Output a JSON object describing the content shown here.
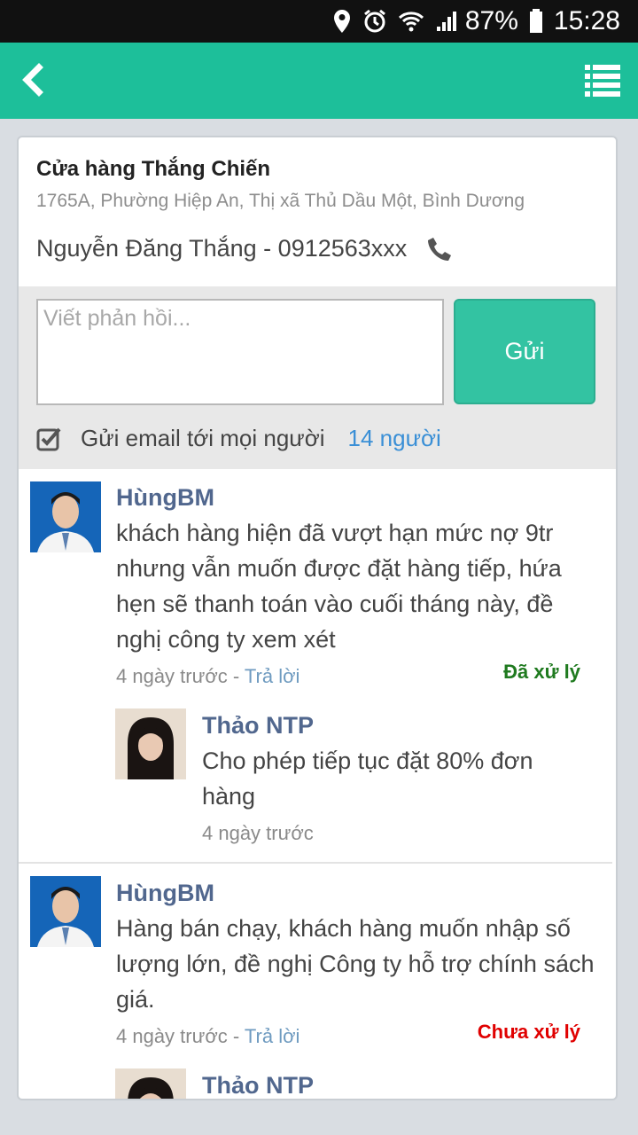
{
  "status_bar": {
    "battery": "87%",
    "time": "15:28",
    "icons": [
      "location-icon",
      "alarm-icon",
      "wifi-icon",
      "signal-icon",
      "battery-icon"
    ]
  },
  "app_bar": {
    "color": "#1dbf9a",
    "back_icon": "back-chevron-icon",
    "menu_icon": "list-menu-icon"
  },
  "store": {
    "name": "Cửa hàng Thắng Chiến",
    "address": "1765A, Phường Hiệp An, Thị xã Thủ Dầu Một, Bình Dương",
    "contact": "Nguyễn Đăng Thắng - 0912563xxx"
  },
  "reply": {
    "placeholder": "Viết phản hồi...",
    "value": "",
    "send_label": "Gửi",
    "email_label": "Gửi email tới mọi người",
    "email_count": "14 người",
    "email_checked": true
  },
  "comments": [
    {
      "author": "HùngBM",
      "text": "khách hàng hiện đã vượt hạn mức nợ 9tr nhưng vẫn muốn được đặt hàng tiếp, hứa hẹn sẽ thanh toán vào cuối tháng này, đề nghị công ty xem xét",
      "time": "4 ngày trước",
      "separator": " - ",
      "reply_label": "Trả lời",
      "status": "Đã xử lý",
      "status_color": "#1f7a1f",
      "replies": [
        {
          "author": "Thảo NTP",
          "text": "Cho phép tiếp tục đặt 80% đơn hàng",
          "time": "4 ngày trước"
        }
      ]
    },
    {
      "author": "HùngBM",
      "text": "Hàng bán chạy, khách hàng muốn nhập số lượng lớn, đề nghị Công ty hỗ trợ chính sách giá.",
      "time": "4 ngày trước",
      "separator": " - ",
      "reply_label": "Trả lời",
      "status": "Chưa xử lý",
      "status_color": "#e00000",
      "replies": [
        {
          "author": "Thảo NTP"
        }
      ]
    }
  ]
}
